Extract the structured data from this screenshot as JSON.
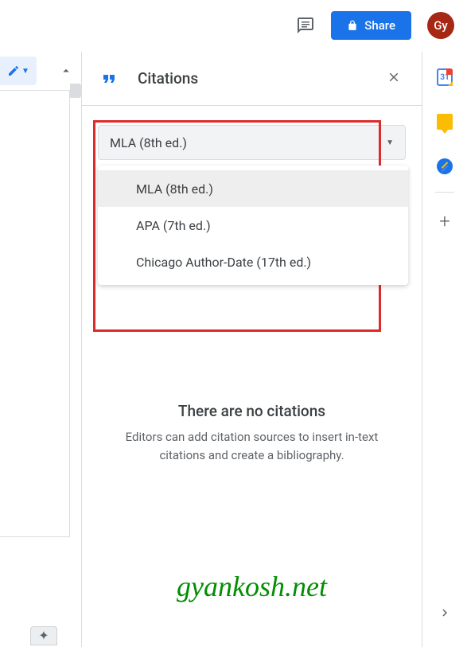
{
  "topbar": {
    "share_label": "Share",
    "avatar_text": "Gy"
  },
  "panel": {
    "title": "Citations"
  },
  "dropdown": {
    "selected": "MLA (8th ed.)",
    "options": [
      "MLA (8th ed.)",
      "APA (7th ed.)",
      "Chicago Author-Date (17th ed.)"
    ]
  },
  "empty": {
    "title": "There are no citations",
    "desc": "Editors can add citation sources to insert in-text citations and create a bibliography."
  },
  "calendar": {
    "day": "31"
  },
  "watermark": "gyankosh.net"
}
